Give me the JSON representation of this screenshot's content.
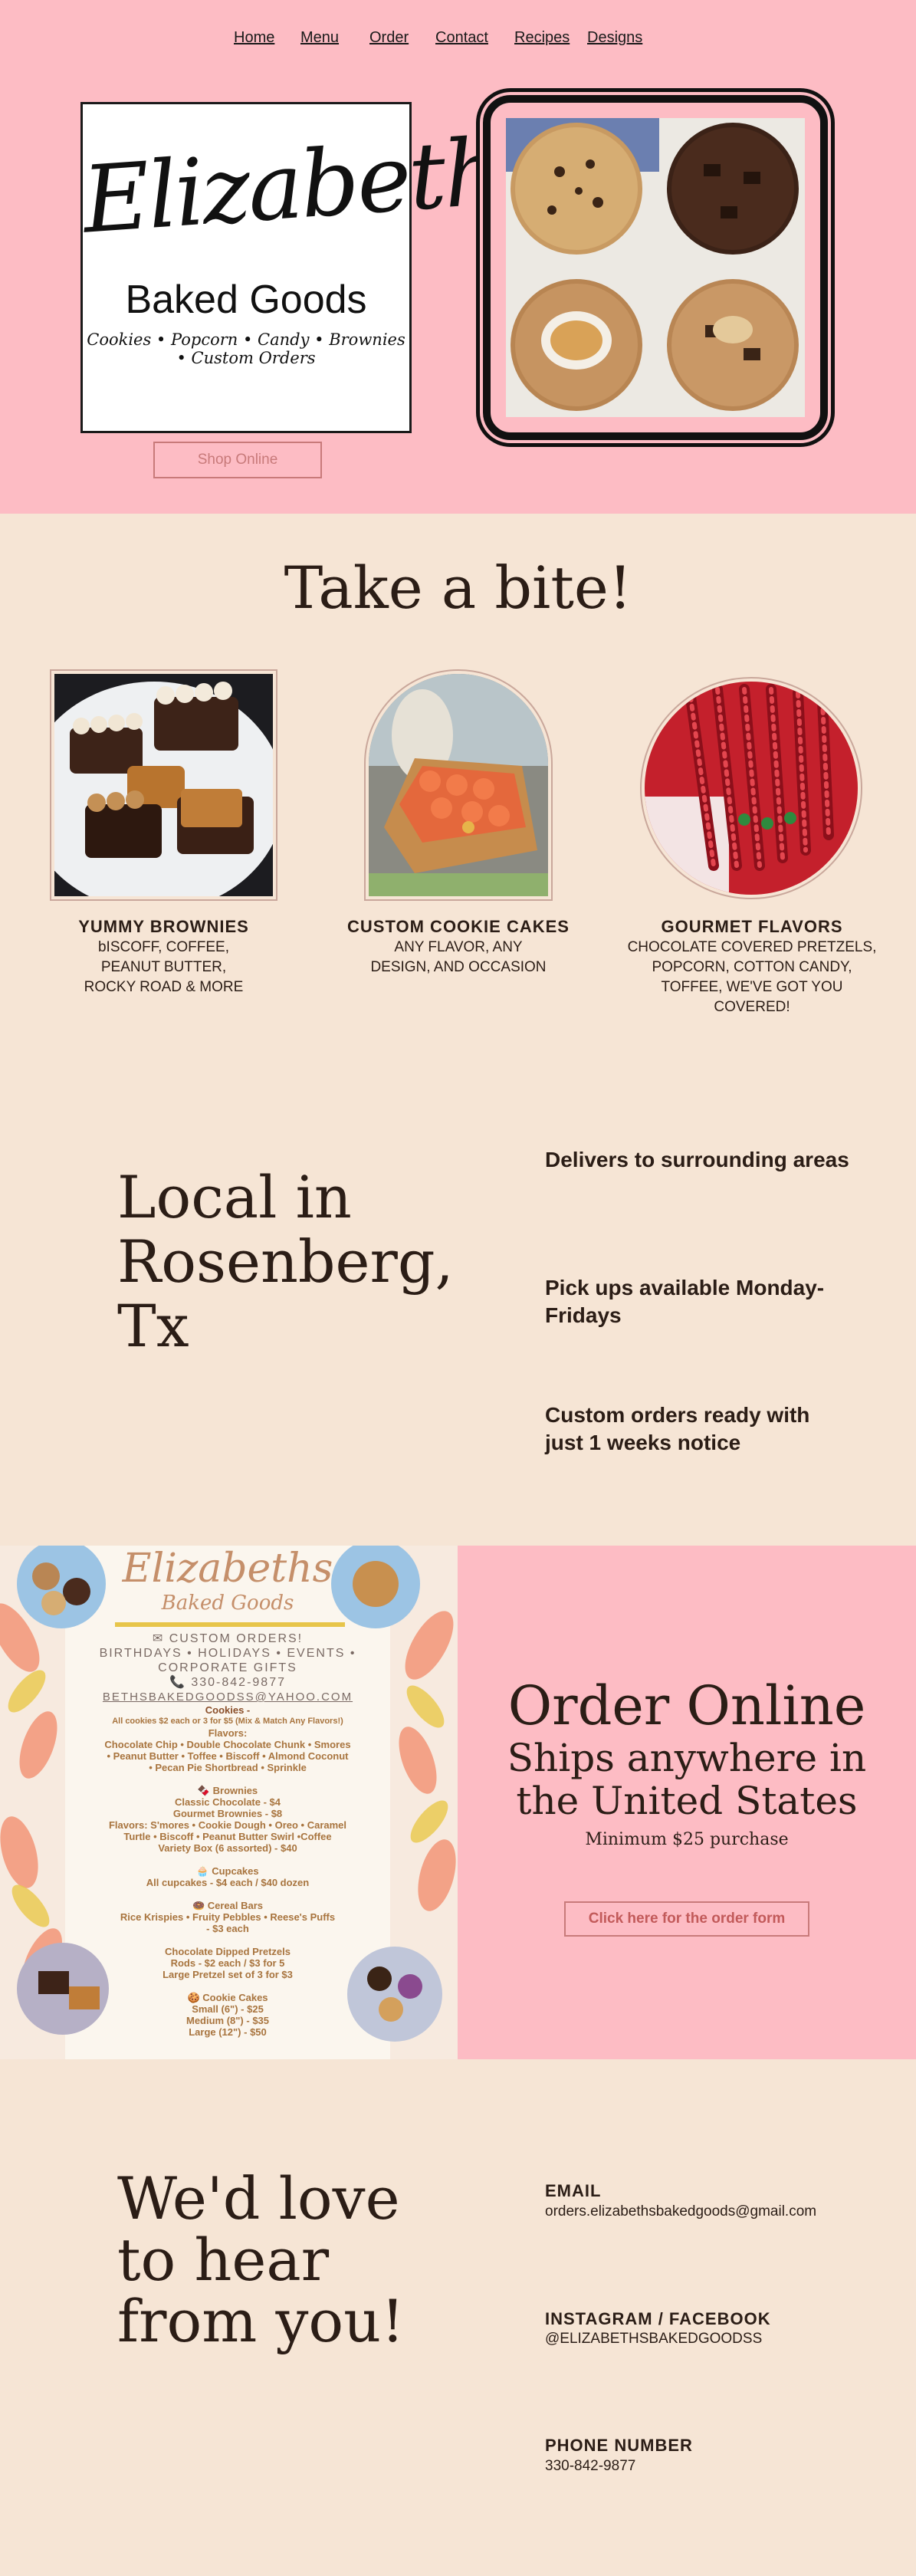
{
  "nav": {
    "items": [
      "Home",
      "Menu",
      "Order",
      "Contact",
      "Recipes",
      "Designs"
    ]
  },
  "logo": {
    "script": "Elizabeth's",
    "subtitle": "Baked Goods",
    "tagline": "Cookies • Popcorn • Candy • Brownies • Custom Orders"
  },
  "hero": {
    "shop_button": "Shop Online"
  },
  "bite": {
    "title": "Take a bite!",
    "cards": [
      {
        "heading": "YUMMY BROWNIES",
        "body": [
          "bISCOFF, COFFEE,",
          "PEANUT BUTTER,",
          "ROCKY ROAD & MORE"
        ]
      },
      {
        "heading": "CUSTOM COOKIE CAKES",
        "body": [
          "ANY FLAVOR, ANY",
          "DESIGN, AND OCCASION"
        ]
      },
      {
        "heading": "GOURMET FLAVORS",
        "body": [
          "CHOCOLATE COVERED PRETZELS,",
          "POPCORN, COTTON CANDY,",
          "TOFFEE, WE'VE GOT YOU",
          "COVERED!"
        ]
      }
    ]
  },
  "local": {
    "title": "Local in Rosenberg, Tx",
    "items": [
      "Delivers to surrounding areas",
      "Pick ups available Monday-Fridays",
      "Custom orders ready with just 1 weeks notice"
    ]
  },
  "flyer": {
    "script": "Elizabeths",
    "script_sub": "Baked Goods",
    "lines": [
      "✉ CUSTOM ORDERS!",
      "BIRTHDAYS • HOLIDAYS • EVENTS •",
      "CORPORATE GIFTS",
      "📞 330-842-9877",
      "BETHSBAKEDGOODSS@YAHOO.COM",
      "Cookies -",
      "All cookies $2 each or 3 for $5 (Mix & Match Any Flavors!)",
      "Flavors:",
      "Chocolate Chip • Double Chocolate Chunk • Smores",
      "• Peanut Butter • Toffee • Biscoff • Almond Coconut",
      "• Pecan Pie Shortbread • Sprinkle",
      "",
      "🍫 Brownies",
      "Classic Chocolate - $4",
      "Gourmet Brownies - $8",
      "Flavors: S'mores • Cookie Dough • Oreo • Caramel",
      "Turtle • Biscoff • Peanut Butter Swirl •Coffee",
      "Variety Box (6 assorted) - $40",
      "",
      "🧁 Cupcakes",
      "All cupcakes - $4 each / $40 dozen",
      "",
      "🍩 Cereal Bars",
      "Rice Krispies • Fruity Pebbles • Reese's Puffs",
      "- $3 each",
      "",
      "Chocolate Dipped Pretzels",
      "Rods - $2 each / $3 for 5",
      "Large Pretzel set of 3 for $3",
      "",
      "🍪 Cookie Cakes",
      "Small (6\") - $25",
      "Medium (8\") - $35",
      "Large (12\") - $50"
    ]
  },
  "order": {
    "title": "Order Online",
    "subtitle_line1": "Ships anywhere in",
    "subtitle_line2": "the United States",
    "minimum": "Minimum $25 purchase",
    "button": "Click here for the order form"
  },
  "contact": {
    "title": "We'd love to hear from you!",
    "email_label": "EMAIL",
    "email_value": "orders.elizabethsbakedgoods@gmail.com",
    "social_label": "INSTAGRAM / FACEBOOK",
    "social_value": "@ELIZABETHSBAKEDGOODSS",
    "phone_label": "PHONE NUMBER",
    "phone_value": "330-842-9877"
  },
  "colors": {
    "pink": "#fdbcc4",
    "cream": "#f6e5d5",
    "text": "#2b1d16",
    "button_border": "#c87a7a"
  }
}
